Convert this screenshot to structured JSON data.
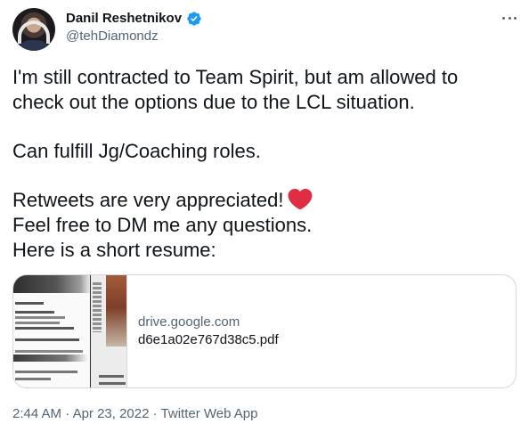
{
  "author": {
    "display_name": "Danil Reshetnikov",
    "handle": "@tehDiamondz"
  },
  "tweet": {
    "lines": [
      "I'm still contracted to Team Spirit, but am allowed to",
      "check out the options due to the LCL situation.",
      "Can fulfill Jg/Coaching roles.",
      "Retweets are very appreciated!",
      "Feel free to DM me any questions.",
      "Here is a short resume:"
    ],
    "emoji": "red-heart"
  },
  "card": {
    "domain": "drive.google.com",
    "title": "d6e1a02e767d38c5.pdf"
  },
  "meta": {
    "time": "2:44 AM",
    "sep1": "·",
    "date": "Apr 23, 2022",
    "sep2": "·",
    "source": "Twitter Web App"
  },
  "icons": {
    "verified": "verified-badge-icon",
    "more": "more-options-icon",
    "heart": "red-heart-emoji"
  },
  "colors": {
    "verified_blue": "#1d9bf0",
    "heart_red": "#dd2e44",
    "secondary_text": "#536471",
    "primary_text": "#0f1419",
    "card_border": "#cfd9de"
  }
}
